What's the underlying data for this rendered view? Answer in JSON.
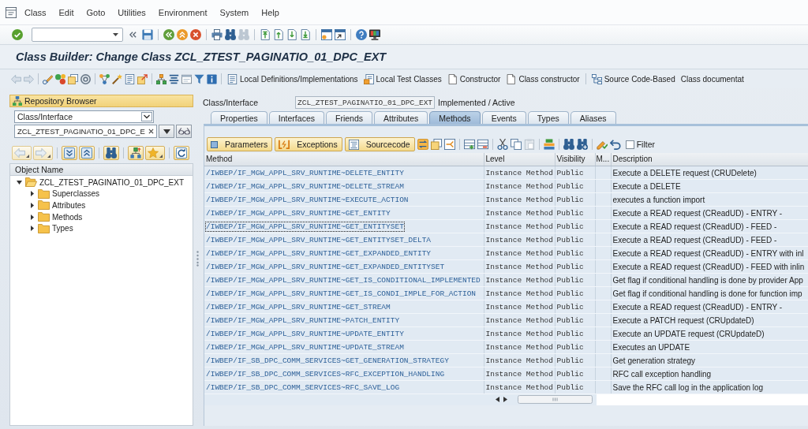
{
  "menu_bar": {
    "items": [
      "Class",
      "Edit",
      "Goto",
      "Utilities",
      "Environment",
      "System",
      "Help"
    ]
  },
  "title": "Class Builder: Change Class ZCL_ZTEST_PAGINATIO_01_DPC_EXT",
  "app_toolbar": {
    "groups": [
      [
        "Local Definitions/Implementations",
        "Local Test Classes",
        "Constructor",
        "Class constructor"
      ],
      [
        "Source Code-Based",
        "Class documentat"
      ]
    ]
  },
  "repository_browser": {
    "title": "Repository Browser",
    "object_type": "Class/Interface",
    "object_name": "ZCL_ZTEST_PAGINATIO_01_DPC_E",
    "tree_header": "Object Name",
    "tree": [
      {
        "label": "ZCL_ZTEST_PAGINATIO_01_DPC_EXT",
        "expanded": true,
        "children": [
          {
            "label": "Superclasses",
            "expanded": false
          },
          {
            "label": "Attributes",
            "expanded": false
          },
          {
            "label": "Methods",
            "expanded": false
          },
          {
            "label": "Types",
            "expanded": false
          }
        ]
      }
    ]
  },
  "class_header": {
    "label": "Class/Interface",
    "value": "ZCL_ZTEST_PAGINATIO_01_DPC_EXT",
    "status": "Implemented / Active"
  },
  "tabs": [
    {
      "label": "Properties",
      "selected": false
    },
    {
      "label": "Interfaces",
      "selected": false
    },
    {
      "label": "Friends",
      "selected": false
    },
    {
      "label": "Attributes",
      "selected": false
    },
    {
      "label": "Methods",
      "selected": true
    },
    {
      "label": "Events",
      "selected": false
    },
    {
      "label": "Types",
      "selected": false
    },
    {
      "label": "Aliases",
      "selected": false
    }
  ],
  "methods_toolbar": {
    "buttons": [
      "Parameters",
      "Exceptions",
      "Sourcecode"
    ],
    "filter": {
      "label": "Filter",
      "checked": false
    }
  },
  "table": {
    "columns": [
      "Method",
      "Level",
      "Visibility",
      "M...",
      "Description"
    ],
    "rows": [
      {
        "method": "/IWBEP/IF_MGW_APPL_SRV_RUNTIME~DELETE_ENTITY",
        "level": "Instance Method",
        "visibility": "Public",
        "description": "Execute a DELETE request (CRUDelete)",
        "focused": false
      },
      {
        "method": "/IWBEP/IF_MGW_APPL_SRV_RUNTIME~DELETE_STREAM",
        "level": "Instance Method",
        "visibility": "Public",
        "description": "Execute a DELETE",
        "focused": false
      },
      {
        "method": "/IWBEP/IF_MGW_APPL_SRV_RUNTIME~EXECUTE_ACTION",
        "level": "Instance Method",
        "visibility": "Public",
        "description": "executes a function import",
        "focused": false
      },
      {
        "method": "/IWBEP/IF_MGW_APPL_SRV_RUNTIME~GET_ENTITY",
        "level": "Instance Method",
        "visibility": "Public",
        "description": "Execute a READ request (CReadUD) - ENTRY -",
        "focused": false
      },
      {
        "method": "/IWBEP/IF_MGW_APPL_SRV_RUNTIME~GET_ENTITYSET",
        "level": "Instance Method",
        "visibility": "Public",
        "description": "Execute a READ request (CReadUD) - FEED -",
        "focused": true
      },
      {
        "method": "/IWBEP/IF_MGW_APPL_SRV_RUNTIME~GET_ENTITYSET_DELTA",
        "level": "Instance Method",
        "visibility": "Public",
        "description": "Execute a READ request (CReadUD) - FEED -",
        "focused": false
      },
      {
        "method": "/IWBEP/IF_MGW_APPL_SRV_RUNTIME~GET_EXPANDED_ENTITY",
        "level": "Instance Method",
        "visibility": "Public",
        "description": "Execute a READ request (CReadUD) - ENTRY with inl",
        "focused": false
      },
      {
        "method": "/IWBEP/IF_MGW_APPL_SRV_RUNTIME~GET_EXPANDED_ENTITYSET",
        "level": "Instance Method",
        "visibility": "Public",
        "description": "Execute a READ request (CReadUD) - FEED with inlin",
        "focused": false
      },
      {
        "method": "/IWBEP/IF_MGW_APPL_SRV_RUNTIME~GET_IS_CONDITIONAL_IMPLEMENTED",
        "level": "Instance Method",
        "visibility": "Public",
        "description": "Get flag if conditional handling is done by provider App",
        "focused": false
      },
      {
        "method": "/IWBEP/IF_MGW_APPL_SRV_RUNTIME~GET_IS_CONDI_IMPLE_FOR_ACTION",
        "level": "Instance Method",
        "visibility": "Public",
        "description": "Get flag if conditional handling is done for function imp",
        "focused": false
      },
      {
        "method": "/IWBEP/IF_MGW_APPL_SRV_RUNTIME~GET_STREAM",
        "level": "Instance Method",
        "visibility": "Public",
        "description": "Execute a READ request (CReadUD) - ENTRY -",
        "focused": false
      },
      {
        "method": "/IWBEP/IF_MGW_APPL_SRV_RUNTIME~PATCH_ENTITY",
        "level": "Instance Method",
        "visibility": "Public",
        "description": "Execute a PATCH request (CRUpdateD)",
        "focused": false
      },
      {
        "method": "/IWBEP/IF_MGW_APPL_SRV_RUNTIME~UPDATE_ENTITY",
        "level": "Instance Method",
        "visibility": "Public",
        "description": "Execute an UPDATE request (CRUpdateD)",
        "focused": false
      },
      {
        "method": "/IWBEP/IF_MGW_APPL_SRV_RUNTIME~UPDATE_STREAM",
        "level": "Instance Method",
        "visibility": "Public",
        "description": "Executes an UPDATE",
        "focused": false
      },
      {
        "method": "/IWBEP/IF_SB_DPC_COMM_SERVICES~GET_GENERATION_STRATEGY",
        "level": "Instance Method",
        "visibility": "Public",
        "description": "Get generation strategy",
        "focused": false
      },
      {
        "method": "/IWBEP/IF_SB_DPC_COMM_SERVICES~RFC_EXCEPTION_HANDLING",
        "level": "Instance Method",
        "visibility": "Public",
        "description": "RFC call exception handling",
        "focused": false
      },
      {
        "method": "/IWBEP/IF_SB_DPC_COMM_SERVICES~RFC_SAVE_LOG",
        "level": "Instance Method",
        "visibility": "Public",
        "description": "Save the RFC call log in the application log",
        "focused": false
      }
    ]
  }
}
